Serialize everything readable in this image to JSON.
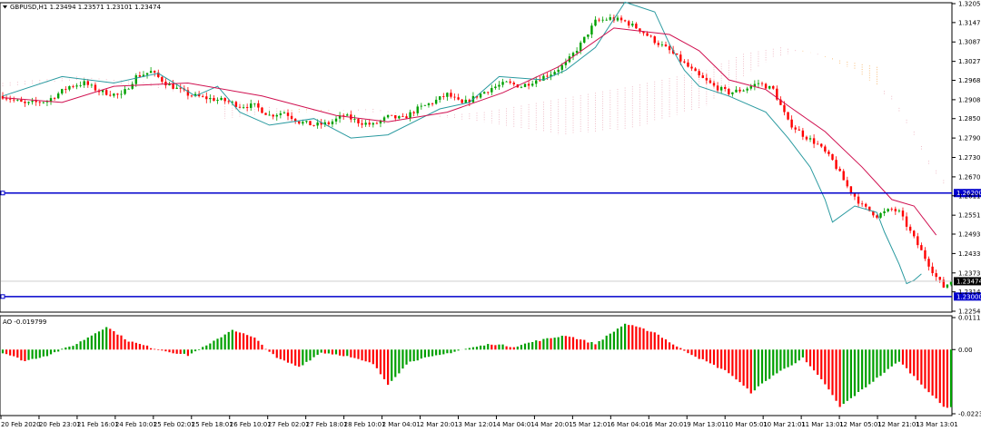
{
  "header": {
    "menu_icon": "triangle-down-icon",
    "title": "GBPUSD,H1  1.23494 1.23571 1.23101 1.23474"
  },
  "indicator": {
    "title": "AO -0.019799"
  },
  "colors": {
    "up": "#00a000",
    "down": "#ff0000",
    "tenkan": "#d01050",
    "kijun": "#2a9aa0",
    "cloud_a": "#f4a040",
    "cloud_b": "#e8a0b0",
    "hline": "#0000cc",
    "price_tag": "#000000"
  },
  "chart_data": [
    {
      "type": "candlestick",
      "symbol": "GBPUSD",
      "timeframe": "H1",
      "ylim": [
        1.22546,
        1.32055
      ],
      "y_ticks": [
        "1.32055",
        "1.31470",
        "1.30870",
        "1.30270",
        "1.29685",
        "1.29085",
        "1.28500",
        "1.27900",
        "1.27300",
        "1.26700",
        "1.26115",
        "1.25515",
        "1.24930",
        "1.24330",
        "1.23730",
        "1.23145",
        "1.22546"
      ],
      "x_ticks": [
        "20 Feb 2020",
        "20 Feb 23:01",
        "21 Feb 16:01",
        "24 Feb 10:01",
        "25 Feb 02:01",
        "25 Feb 18:01",
        "26 Feb 10:01",
        "27 Feb 02:01",
        "27 Feb 18:01",
        "28 Feb 10:01",
        "2 Mar 04:01",
        "2 Mar 20:01",
        "3 Mar 12:01",
        "4 Mar 04:01",
        "4 Mar 20:01",
        "5 Mar 12:01",
        "6 Mar 04:01",
        "6 Mar 20:01",
        "9 Mar 13:01",
        "10 Mar 05:01",
        "10 Mar 21:01",
        "11 Mar 13:01",
        "12 Mar 05:01",
        "12 Mar 21:01",
        "13 Mar 13:01"
      ],
      "last_price": "1.23474",
      "horizontal_lines": [
        {
          "value": 1.262,
          "label": "1.26200"
        },
        {
          "value": 1.23,
          "label": "1.23000"
        }
      ],
      "close_path": [
        [
          0,
          1.292
        ],
        [
          6,
          1.2895
        ],
        [
          12,
          1.2905
        ],
        [
          18,
          1.295
        ],
        [
          22,
          1.296
        ],
        [
          26,
          1.2935
        ],
        [
          32,
          1.292
        ],
        [
          36,
          1.298
        ],
        [
          40,
          1.2995
        ],
        [
          44,
          1.296
        ],
        [
          50,
          1.2925
        ],
        [
          54,
          1.2915
        ],
        [
          60,
          1.2905
        ],
        [
          64,
          1.289
        ],
        [
          68,
          1.289
        ],
        [
          72,
          1.286
        ],
        [
          76,
          1.287
        ],
        [
          80,
          1.284
        ],
        [
          84,
          1.283
        ],
        [
          88,
          1.2835
        ],
        [
          92,
          1.286
        ],
        [
          96,
          1.284
        ],
        [
          100,
          1.283
        ],
        [
          104,
          1.2855
        ],
        [
          108,
          1.285
        ],
        [
          112,
          1.288
        ],
        [
          116,
          1.29
        ],
        [
          120,
          1.2925
        ],
        [
          124,
          1.2895
        ],
        [
          128,
          1.292
        ],
        [
          132,
          1.2945
        ],
        [
          136,
          1.296
        ],
        [
          140,
          1.295
        ],
        [
          144,
          1.297
        ],
        [
          148,
          1.299
        ],
        [
          152,
          1.302
        ],
        [
          156,
          1.308
        ],
        [
          160,
          1.315
        ],
        [
          164,
          1.316
        ],
        [
          168,
          1.315
        ],
        [
          172,
          1.3125
        ],
        [
          176,
          1.309
        ],
        [
          180,
          1.306
        ],
        [
          184,
          1.302
        ],
        [
          188,
          1.298
        ],
        [
          192,
          1.295
        ],
        [
          196,
          1.293
        ],
        [
          200,
          1.294
        ],
        [
          204,
          1.296
        ],
        [
          208,
          1.294
        ],
        [
          212,
          1.284
        ],
        [
          216,
          1.28
        ],
        [
          220,
          1.277
        ],
        [
          224,
          1.272
        ],
        [
          228,
          1.264
        ],
        [
          232,
          1.258
        ],
        [
          236,
          1.255
        ],
        [
          240,
          1.257
        ],
        [
          242,
          1.256
        ],
        [
          246,
          1.248
        ],
        [
          250,
          1.24
        ],
        [
          252,
          1.236
        ],
        [
          254,
          1.233
        ],
        [
          256,
          1.2347
        ]
      ],
      "tenkan_path": [
        [
          0,
          1.2915
        ],
        [
          16,
          1.29
        ],
        [
          30,
          1.295
        ],
        [
          50,
          1.296
        ],
        [
          70,
          1.292
        ],
        [
          90,
          1.286
        ],
        [
          104,
          1.284
        ],
        [
          120,
          1.287
        ],
        [
          135,
          1.293
        ],
        [
          150,
          1.301
        ],
        [
          165,
          1.313
        ],
        [
          180,
          1.311
        ],
        [
          188,
          1.306
        ],
        [
          196,
          1.297
        ],
        [
          206,
          1.294
        ],
        [
          212,
          1.289
        ],
        [
          222,
          1.281
        ],
        [
          232,
          1.27
        ],
        [
          240,
          1.26
        ],
        [
          246,
          1.258
        ],
        [
          252,
          1.249
        ]
      ],
      "kijun_path": [
        [
          0,
          1.292
        ],
        [
          16,
          1.298
        ],
        [
          30,
          1.296
        ],
        [
          42,
          1.299
        ],
        [
          52,
          1.292
        ],
        [
          58,
          1.295
        ],
        [
          64,
          1.287
        ],
        [
          72,
          1.283
        ],
        [
          84,
          1.285
        ],
        [
          94,
          1.279
        ],
        [
          104,
          1.28
        ],
        [
          118,
          1.288
        ],
        [
          126,
          1.29
        ],
        [
          134,
          1.298
        ],
        [
          146,
          1.297
        ],
        [
          152,
          1.3
        ],
        [
          160,
          1.307
        ],
        [
          168,
          1.321
        ],
        [
          176,
          1.318
        ],
        [
          180,
          1.308
        ],
        [
          184,
          1.3
        ],
        [
          188,
          1.295
        ],
        [
          196,
          1.292
        ],
        [
          206,
          1.287
        ],
        [
          212,
          1.279
        ],
        [
          218,
          1.27
        ],
        [
          222,
          1.26
        ],
        [
          224,
          1.253
        ],
        [
          230,
          1.258
        ],
        [
          236,
          1.256
        ],
        [
          238,
          1.25
        ],
        [
          242,
          1.24
        ],
        [
          244,
          1.234
        ],
        [
          246,
          1.235
        ],
        [
          248,
          1.237
        ]
      ],
      "cloud_a_path": [
        [
          60,
          1.285
        ],
        [
          80,
          1.288
        ],
        [
          100,
          1.287
        ],
        [
          114,
          1.286
        ],
        [
          130,
          1.284
        ],
        [
          150,
          1.28
        ],
        [
          170,
          1.282
        ],
        [
          190,
          1.289
        ],
        [
          200,
          1.298
        ],
        [
          208,
          1.304
        ],
        [
          216,
          1.306
        ],
        [
          226,
          1.303
        ],
        [
          236,
          1.301
        ]
      ],
      "cloud_b_path": [
        [
          0,
          1.296
        ],
        [
          20,
          1.298
        ],
        [
          40,
          1.296
        ],
        [
          60,
          1.291
        ],
        [
          80,
          1.287
        ],
        [
          100,
          1.288
        ],
        [
          114,
          1.2855
        ],
        [
          130,
          1.287
        ],
        [
          150,
          1.291
        ],
        [
          170,
          1.295
        ],
        [
          190,
          1.3
        ],
        [
          200,
          1.305
        ],
        [
          210,
          1.307
        ],
        [
          220,
          1.305
        ],
        [
          230,
          1.3
        ],
        [
          240,
          1.292
        ],
        [
          246,
          1.281
        ],
        [
          250,
          1.272
        ],
        [
          256,
          1.263
        ],
        [
          264,
          1.256
        ],
        [
          270,
          1.25
        ]
      ]
    },
    {
      "type": "bar",
      "name": "AO",
      "ylim": [
        -0.022371,
        0.011156
      ],
      "y_ticks": [
        "0.011156",
        "0.00",
        "-0.022371"
      ],
      "last_value": -0.019799,
      "ao_path": [
        [
          0,
          -0.001
        ],
        [
          6,
          -0.004
        ],
        [
          12,
          -0.002
        ],
        [
          20,
          0.002
        ],
        [
          28,
          0.008
        ],
        [
          34,
          0.003
        ],
        [
          42,
          0.0
        ],
        [
          50,
          -0.002
        ],
        [
          56,
          0.002
        ],
        [
          62,
          0.007
        ],
        [
          68,
          0.004
        ],
        [
          74,
          -0.003
        ],
        [
          80,
          -0.006
        ],
        [
          86,
          -0.001
        ],
        [
          92,
          -0.002
        ],
        [
          100,
          -0.005
        ],
        [
          104,
          -0.012
        ],
        [
          110,
          -0.004
        ],
        [
          118,
          -0.002
        ],
        [
          124,
          0.0
        ],
        [
          132,
          0.002
        ],
        [
          138,
          0.001
        ],
        [
          144,
          0.003
        ],
        [
          152,
          0.005
        ],
        [
          160,
          0.002
        ],
        [
          168,
          0.009
        ],
        [
          176,
          0.006
        ],
        [
          182,
          0.001
        ],
        [
          188,
          -0.003
        ],
        [
          196,
          -0.008
        ],
        [
          202,
          -0.015
        ],
        [
          208,
          -0.009
        ],
        [
          216,
          -0.003
        ],
        [
          222,
          -0.012
        ],
        [
          226,
          -0.02
        ],
        [
          230,
          -0.016
        ],
        [
          236,
          -0.01
        ],
        [
          242,
          -0.004
        ],
        [
          248,
          -0.012
        ],
        [
          254,
          -0.02
        ]
      ]
    }
  ]
}
